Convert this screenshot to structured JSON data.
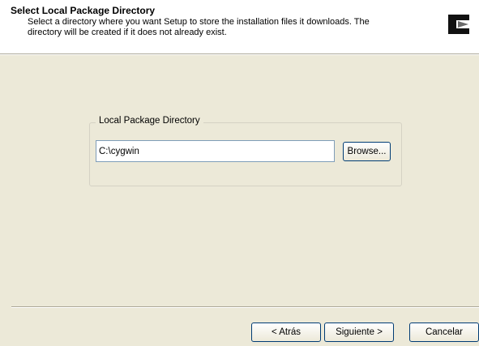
{
  "header": {
    "title": "Select Local Package Directory",
    "description": "Select a directory where you want Setup to store the installation files it downloads.  The directory will be created if it does not already exist.",
    "logo_icon": "cygwin-logo-icon"
  },
  "group": {
    "label": "Local Package Directory",
    "directory_value": "C:\\cygwin",
    "browse_label": "Browse..."
  },
  "footer": {
    "back_label": "< Atrás",
    "next_label": "Siguiente >",
    "cancel_label": "Cancelar"
  },
  "colors": {
    "dialog_background": "#ece9d8",
    "header_background": "#ffffff",
    "button_border": "#003c74",
    "input_border": "#7f9db9"
  }
}
